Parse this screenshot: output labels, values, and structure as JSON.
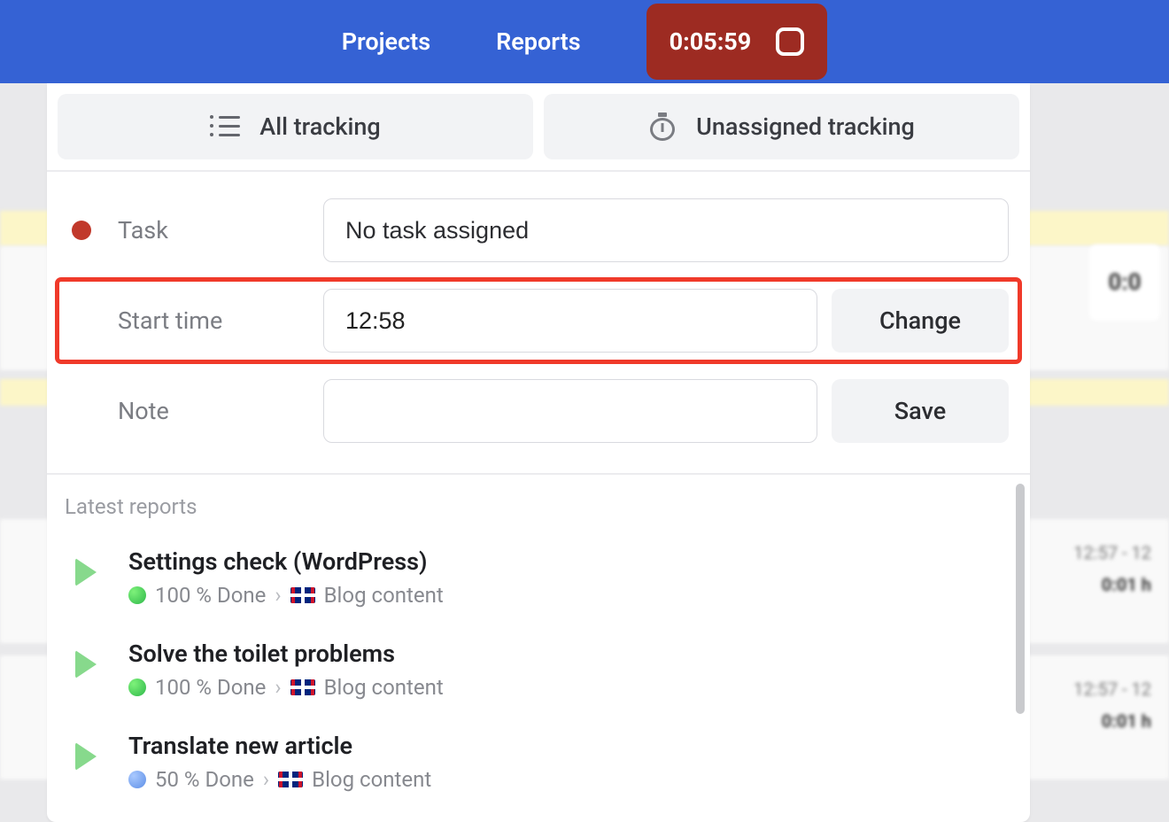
{
  "topbar": {
    "projects": "Projects",
    "reports": "Reports",
    "timer": "0:05:59"
  },
  "tabs": {
    "all_tracking": "All tracking",
    "unassigned_tracking": "Unassigned tracking"
  },
  "form": {
    "task_label": "Task",
    "task_value": "No task assigned",
    "start_label": "Start time",
    "start_value": "12:58",
    "change_btn": "Change",
    "note_label": "Note",
    "note_value": "",
    "save_btn": "Save"
  },
  "reports_heading": "Latest reports",
  "reports": [
    {
      "title": "Settings check (WordPress)",
      "status_color": "green",
      "percent_text": "100 % Done",
      "project": "Blog content"
    },
    {
      "title": "Solve the toilet problems",
      "status_color": "green",
      "percent_text": "100 % Done",
      "project": "Blog content"
    },
    {
      "title": "Translate new article",
      "status_color": "blue",
      "percent_text": "50 % Done",
      "project": "Blog content"
    }
  ],
  "background": {
    "right_card_time": "0:0",
    "row1_range": "12:57 - 12",
    "row1_dur": "0:01 h",
    "row2_range": "12:57 - 12",
    "row2_dur": "0:01 h"
  }
}
